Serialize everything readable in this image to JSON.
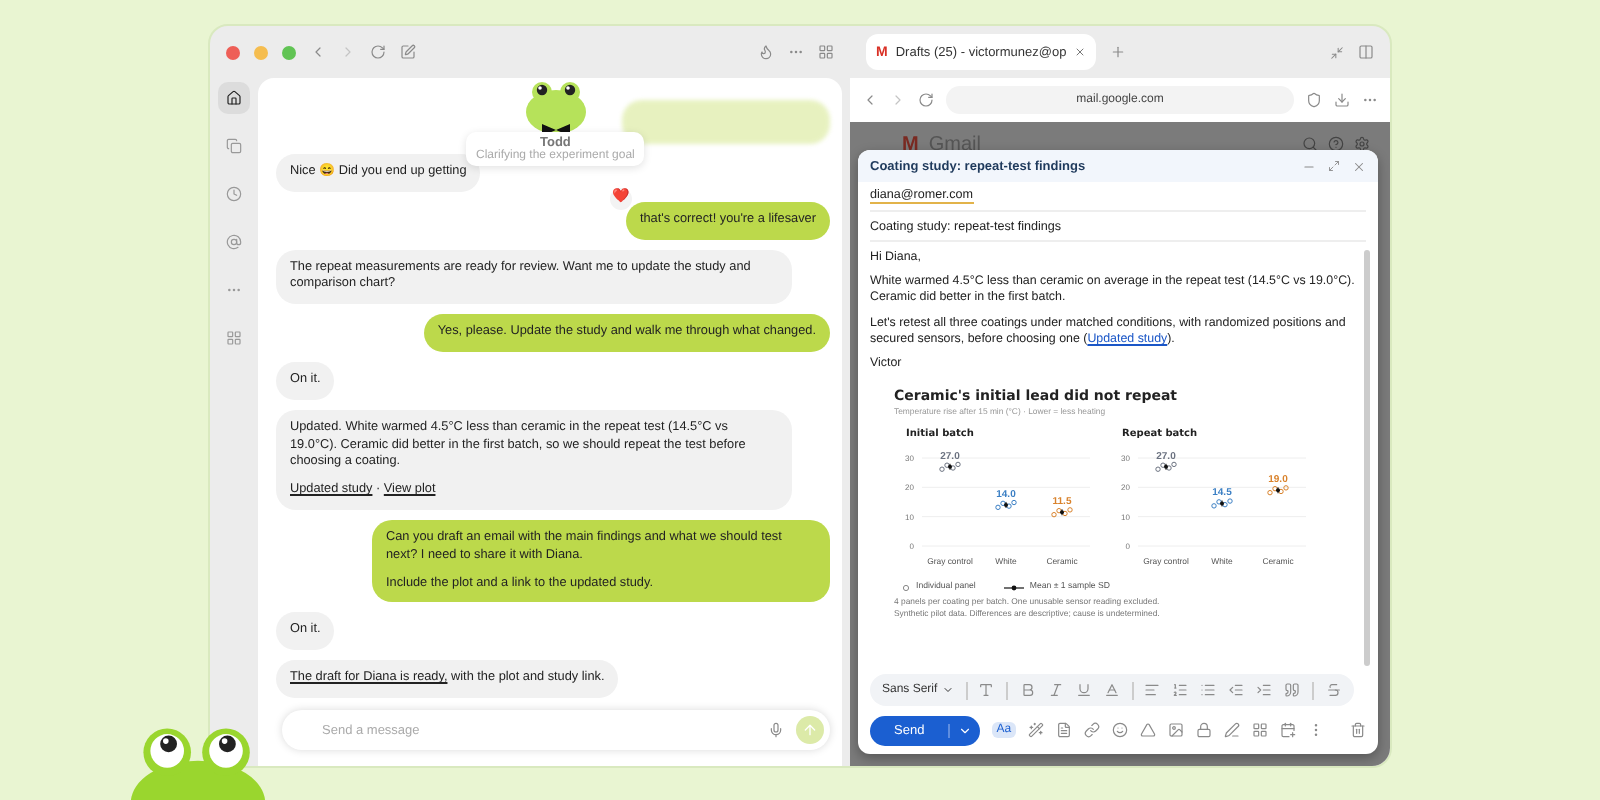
{
  "top_bar": {
    "tabs": [
      {
        "logo": "M",
        "title": "Drafts (25) - victormunez@op",
        "selected": true
      }
    ],
    "address": "mail.google.com"
  },
  "sidebar": [
    {
      "kind": "home",
      "selected": true
    },
    {
      "kind": "copy",
      "selected": false
    },
    {
      "kind": "clock",
      "selected": false
    },
    {
      "kind": "at",
      "selected": false
    },
    {
      "kind": "more",
      "selected": false
    },
    {
      "kind": "apps",
      "selected": false
    }
  ],
  "mascot": {
    "name": "Todd",
    "status": "Clarifying the experiment goal"
  },
  "chat": {
    "messages": [
      {
        "kind": "user",
        "faded": true
      },
      {
        "kind": "assistant",
        "faded": false,
        "paragraphs": [
          "Nice 😄 Did you end up getting"
        ]
      },
      {
        "kind": "user",
        "faded": false,
        "reaction": "❤️",
        "paragraphs": [
          "that's correct! you're a lifesaver"
        ]
      },
      {
        "kind": "assistant",
        "faded": false,
        "paragraphs": [
          "The repeat measurements are ready for review. Want me to update the study and comparison chart?"
        ]
      },
      {
        "kind": "user",
        "faded": false,
        "paragraphs": [
          "Yes, please. Update the study and walk me through what changed."
        ]
      },
      {
        "kind": "assistant",
        "faded": false,
        "paragraphs": [
          "On it."
        ]
      },
      {
        "kind": "assistant",
        "faded": false,
        "paragraphs": [
          "Updated. White warmed 4.5°C less than ceramic in the repeat test (14.5°C vs 19.0°C). Ceramic did better in the first batch, so we should repeat the test before choosing a coating."
        ],
        "links": [
          "Updated study",
          "View plot"
        ],
        "link_separator": "·"
      },
      {
        "kind": "user",
        "faded": false,
        "paragraphs": [
          "Can you draft an email with the main findings and what we should test next? I need to share it with Diana.",
          "Include the plot and a link to the updated study."
        ]
      },
      {
        "kind": "assistant",
        "faded": false,
        "paragraphs": [
          "On it."
        ]
      },
      {
        "kind": "assistant",
        "faded": false,
        "lead_link": "The draft for Diana is ready,",
        "paragraphs": [
          "with the plot and study link."
        ]
      }
    ],
    "input": {
      "placeholder": "Send a message"
    }
  },
  "gmail": {
    "logo": "M",
    "title": "Gmail"
  },
  "compose": {
    "title": "Coating study: repeat-test findings",
    "to": "diana@romer.com",
    "subject": "Coating study: repeat-test findings",
    "greeting": "Hi Diana,",
    "paragraph_1": "White warmed 4.5°C less than ceramic on average in the repeat test (14.5°C vs 19.0°C). Ceramic did better in the first batch.",
    "paragraph_2": {
      "before": "Let's retest all three coatings under matched conditions, with randomized positions and secured sensors, before choosing one (",
      "link": "Updated study",
      "after": ")."
    },
    "signature": "Victor",
    "figure": {
      "title": "Ceramic's initial lead did not repeat",
      "subtitle": "Temperature rise after 15 min (°C) · Lower = less heating",
      "panels": [
        {
          "chart_data": {
            "type": "scatter",
            "title": "Initial batch",
            "categories": [
              "Gray control",
              "White",
              "Ceramic"
            ],
            "ylim": [
              0,
              30
            ],
            "yticks": [
              0,
              10,
              20,
              30
            ],
            "series": [
              {
                "values": [
                  27.0,
                  14.0,
                  11.5
                ],
                "value_labels": [
                  "27.0",
                  "14.0",
                  "11.5"
                ]
              }
            ]
          }
        },
        {
          "chart_data": {
            "type": "scatter",
            "title": "Repeat batch",
            "categories": [
              "Gray control",
              "White",
              "Ceramic"
            ],
            "ylim": [
              0,
              30
            ],
            "yticks": [
              0,
              10,
              20,
              30
            ],
            "series": [
              {
                "values": [
                  27.0,
                  14.5,
                  19.0
                ],
                "value_labels": [
                  "27.0",
                  "14.5",
                  "19.0"
                ]
              }
            ]
          }
        }
      ],
      "legend": [
        "Individual panel",
        "Mean ± 1 sample SD"
      ],
      "notes": [
        "4 panels per coating per batch. One unusable sensor reading excluded.",
        "Synthetic pilot data. Differences are descriptive; cause is undetermined."
      ]
    },
    "font": "Sans Serif",
    "format_button": "Aa",
    "send": "Send"
  }
}
